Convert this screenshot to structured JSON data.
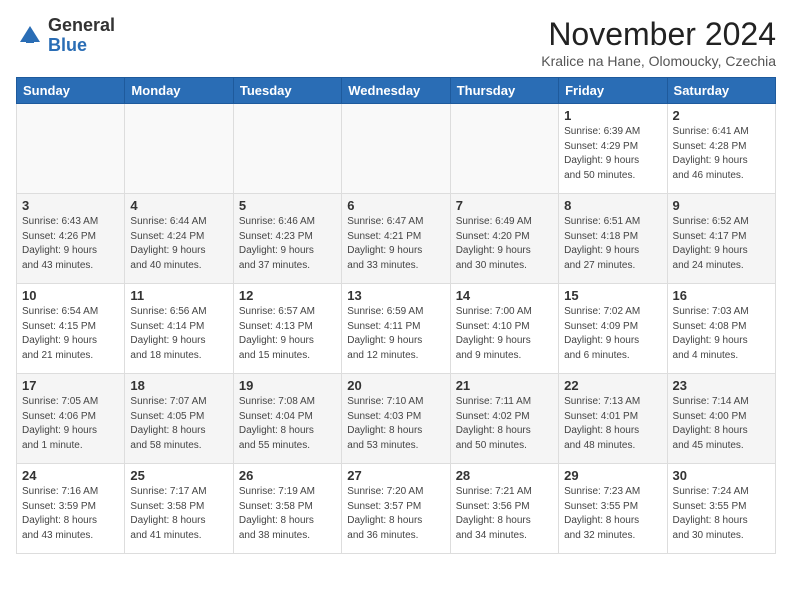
{
  "logo": {
    "general": "General",
    "blue": "Blue"
  },
  "title": {
    "month": "November 2024",
    "location": "Kralice na Hane, Olomoucky, Czechia"
  },
  "days_of_week": [
    "Sunday",
    "Monday",
    "Tuesday",
    "Wednesday",
    "Thursday",
    "Friday",
    "Saturday"
  ],
  "weeks": [
    [
      {
        "day": "",
        "info": ""
      },
      {
        "day": "",
        "info": ""
      },
      {
        "day": "",
        "info": ""
      },
      {
        "day": "",
        "info": ""
      },
      {
        "day": "",
        "info": ""
      },
      {
        "day": "1",
        "info": "Sunrise: 6:39 AM\nSunset: 4:29 PM\nDaylight: 9 hours\nand 50 minutes."
      },
      {
        "day": "2",
        "info": "Sunrise: 6:41 AM\nSunset: 4:28 PM\nDaylight: 9 hours\nand 46 minutes."
      }
    ],
    [
      {
        "day": "3",
        "info": "Sunrise: 6:43 AM\nSunset: 4:26 PM\nDaylight: 9 hours\nand 43 minutes."
      },
      {
        "day": "4",
        "info": "Sunrise: 6:44 AM\nSunset: 4:24 PM\nDaylight: 9 hours\nand 40 minutes."
      },
      {
        "day": "5",
        "info": "Sunrise: 6:46 AM\nSunset: 4:23 PM\nDaylight: 9 hours\nand 37 minutes."
      },
      {
        "day": "6",
        "info": "Sunrise: 6:47 AM\nSunset: 4:21 PM\nDaylight: 9 hours\nand 33 minutes."
      },
      {
        "day": "7",
        "info": "Sunrise: 6:49 AM\nSunset: 4:20 PM\nDaylight: 9 hours\nand 30 minutes."
      },
      {
        "day": "8",
        "info": "Sunrise: 6:51 AM\nSunset: 4:18 PM\nDaylight: 9 hours\nand 27 minutes."
      },
      {
        "day": "9",
        "info": "Sunrise: 6:52 AM\nSunset: 4:17 PM\nDaylight: 9 hours\nand 24 minutes."
      }
    ],
    [
      {
        "day": "10",
        "info": "Sunrise: 6:54 AM\nSunset: 4:15 PM\nDaylight: 9 hours\nand 21 minutes."
      },
      {
        "day": "11",
        "info": "Sunrise: 6:56 AM\nSunset: 4:14 PM\nDaylight: 9 hours\nand 18 minutes."
      },
      {
        "day": "12",
        "info": "Sunrise: 6:57 AM\nSunset: 4:13 PM\nDaylight: 9 hours\nand 15 minutes."
      },
      {
        "day": "13",
        "info": "Sunrise: 6:59 AM\nSunset: 4:11 PM\nDaylight: 9 hours\nand 12 minutes."
      },
      {
        "day": "14",
        "info": "Sunrise: 7:00 AM\nSunset: 4:10 PM\nDaylight: 9 hours\nand 9 minutes."
      },
      {
        "day": "15",
        "info": "Sunrise: 7:02 AM\nSunset: 4:09 PM\nDaylight: 9 hours\nand 6 minutes."
      },
      {
        "day": "16",
        "info": "Sunrise: 7:03 AM\nSunset: 4:08 PM\nDaylight: 9 hours\nand 4 minutes."
      }
    ],
    [
      {
        "day": "17",
        "info": "Sunrise: 7:05 AM\nSunset: 4:06 PM\nDaylight: 9 hours\nand 1 minute."
      },
      {
        "day": "18",
        "info": "Sunrise: 7:07 AM\nSunset: 4:05 PM\nDaylight: 8 hours\nand 58 minutes."
      },
      {
        "day": "19",
        "info": "Sunrise: 7:08 AM\nSunset: 4:04 PM\nDaylight: 8 hours\nand 55 minutes."
      },
      {
        "day": "20",
        "info": "Sunrise: 7:10 AM\nSunset: 4:03 PM\nDaylight: 8 hours\nand 53 minutes."
      },
      {
        "day": "21",
        "info": "Sunrise: 7:11 AM\nSunset: 4:02 PM\nDaylight: 8 hours\nand 50 minutes."
      },
      {
        "day": "22",
        "info": "Sunrise: 7:13 AM\nSunset: 4:01 PM\nDaylight: 8 hours\nand 48 minutes."
      },
      {
        "day": "23",
        "info": "Sunrise: 7:14 AM\nSunset: 4:00 PM\nDaylight: 8 hours\nand 45 minutes."
      }
    ],
    [
      {
        "day": "24",
        "info": "Sunrise: 7:16 AM\nSunset: 3:59 PM\nDaylight: 8 hours\nand 43 minutes."
      },
      {
        "day": "25",
        "info": "Sunrise: 7:17 AM\nSunset: 3:58 PM\nDaylight: 8 hours\nand 41 minutes."
      },
      {
        "day": "26",
        "info": "Sunrise: 7:19 AM\nSunset: 3:58 PM\nDaylight: 8 hours\nand 38 minutes."
      },
      {
        "day": "27",
        "info": "Sunrise: 7:20 AM\nSunset: 3:57 PM\nDaylight: 8 hours\nand 36 minutes."
      },
      {
        "day": "28",
        "info": "Sunrise: 7:21 AM\nSunset: 3:56 PM\nDaylight: 8 hours\nand 34 minutes."
      },
      {
        "day": "29",
        "info": "Sunrise: 7:23 AM\nSunset: 3:55 PM\nDaylight: 8 hours\nand 32 minutes."
      },
      {
        "day": "30",
        "info": "Sunrise: 7:24 AM\nSunset: 3:55 PM\nDaylight: 8 hours\nand 30 minutes."
      }
    ]
  ]
}
